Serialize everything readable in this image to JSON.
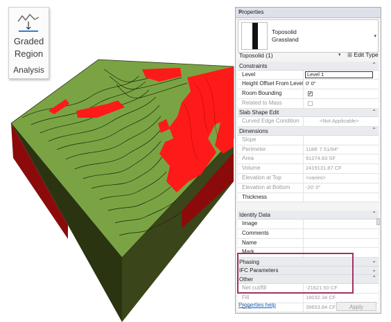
{
  "ribbon": {
    "button_line1": "Graded",
    "button_line2": "Region",
    "panel_label": "Analysis",
    "icon": "graded-region-icon"
  },
  "properties": {
    "title": "Properties",
    "close_glyph": "✕",
    "type_family": "Toposolid",
    "type_name": "Grassland",
    "instance_selector": "Toposolid (1)",
    "edit_type_label": "Edit Type",
    "sections": {
      "constraints": {
        "label": "Constraints",
        "collapse": "⌃",
        "rows": {
          "level": {
            "label": "Level",
            "value": "Level 1"
          },
          "height_offset": {
            "label": "Height Offset From Level",
            "value": "0'  0\""
          },
          "room_bounding": {
            "label": "Room Bounding",
            "checked": true
          },
          "related_to_mass": {
            "label": "Related to Mass",
            "checked": false
          }
        }
      },
      "slab_shape_edit": {
        "label": "Slab Shape Edit",
        "collapse": "⌃",
        "rows": {
          "curved_edge": {
            "label": "Curved Edge Condition",
            "value": "<Not Applicable>"
          }
        }
      },
      "dimensions": {
        "label": "Dimensions",
        "collapse": "⌃",
        "rows": {
          "slope": {
            "label": "Slope",
            "value": ""
          },
          "perimeter": {
            "label": "Perimeter",
            "value": "1188'  7 51/64\""
          },
          "area": {
            "label": "Area",
            "value": "91274.83 SF"
          },
          "volume": {
            "label": "Volume",
            "value": "2419131.87 CF"
          },
          "elev_top": {
            "label": "Elevation at Top",
            "value": "<varies>"
          },
          "elev_bottom": {
            "label": "Elevation at Bottom",
            "value": "-20'  0\""
          },
          "thickness": {
            "label": "Thickness",
            "value": ""
          }
        }
      },
      "identity_data": {
        "label": "Identity Data",
        "collapse": "⌃",
        "rows": {
          "image": {
            "label": "Image",
            "value": ""
          },
          "comments": {
            "label": "Comments",
            "value": ""
          },
          "name": {
            "label": "Name",
            "value": ""
          },
          "mark": {
            "label": "Mark",
            "value": ""
          }
        }
      },
      "phasing": {
        "label": "Phasing",
        "collapse": "⌄"
      },
      "ifc_parameters": {
        "label": "IFC Parameters",
        "collapse": "⌄"
      },
      "other": {
        "label": "Other",
        "collapse": "⌃",
        "rows": {
          "net_cut_fill": {
            "label": "Net cut/fill",
            "value": "-21621.50 CF"
          },
          "fill": {
            "label": "Fill",
            "value": "18032.34 CF"
          },
          "cut": {
            "label": "Cut",
            "value": "39653.84 CF"
          }
        }
      }
    },
    "help_link": "Properties help",
    "apply_label": "Apply"
  },
  "colors": {
    "terrain_green": "#7aa444",
    "cut_red": "#ff1a1a",
    "side_dark": "#2b3512",
    "highlight_box": "#a03063"
  }
}
